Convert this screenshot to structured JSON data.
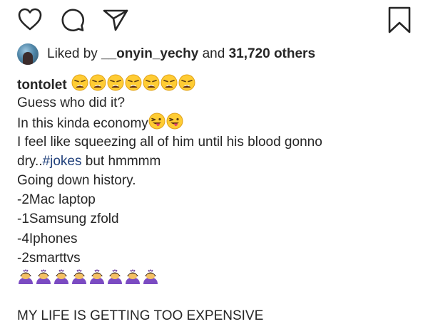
{
  "actions": {
    "like_icon": "heart-icon",
    "comment_icon": "comment-icon",
    "share_icon": "paper-plane-icon",
    "save_icon": "bookmark-icon"
  },
  "likes": {
    "prefix": "Liked by ",
    "user": "__onyin_yechy",
    "middle": " and ",
    "count": "31,720 others"
  },
  "post": {
    "username": "tontolet",
    "line1": "Guess who did it?",
    "line2": "In this kinda economy",
    "line3": "I feel like squeezing all of him until his blood gonno",
    "line4_prefix": "dry..",
    "hashtag": "#jokes",
    "line4_suffix": " but hmmmm",
    "line5": "Going down history.",
    "item1": "-2Mac laptop",
    "item2": "-1Samsung zfold",
    "item3": "-4Iphones",
    "item4": "-2smarttvs",
    "closing": "MY LIFE IS GETTING TOO EXPENSIVE"
  },
  "colors": {
    "text": "#262626",
    "hashtag": "#1f3f7a",
    "emoji_face": "#ffcc33",
    "emoji_purple": "#7b4bc2"
  }
}
